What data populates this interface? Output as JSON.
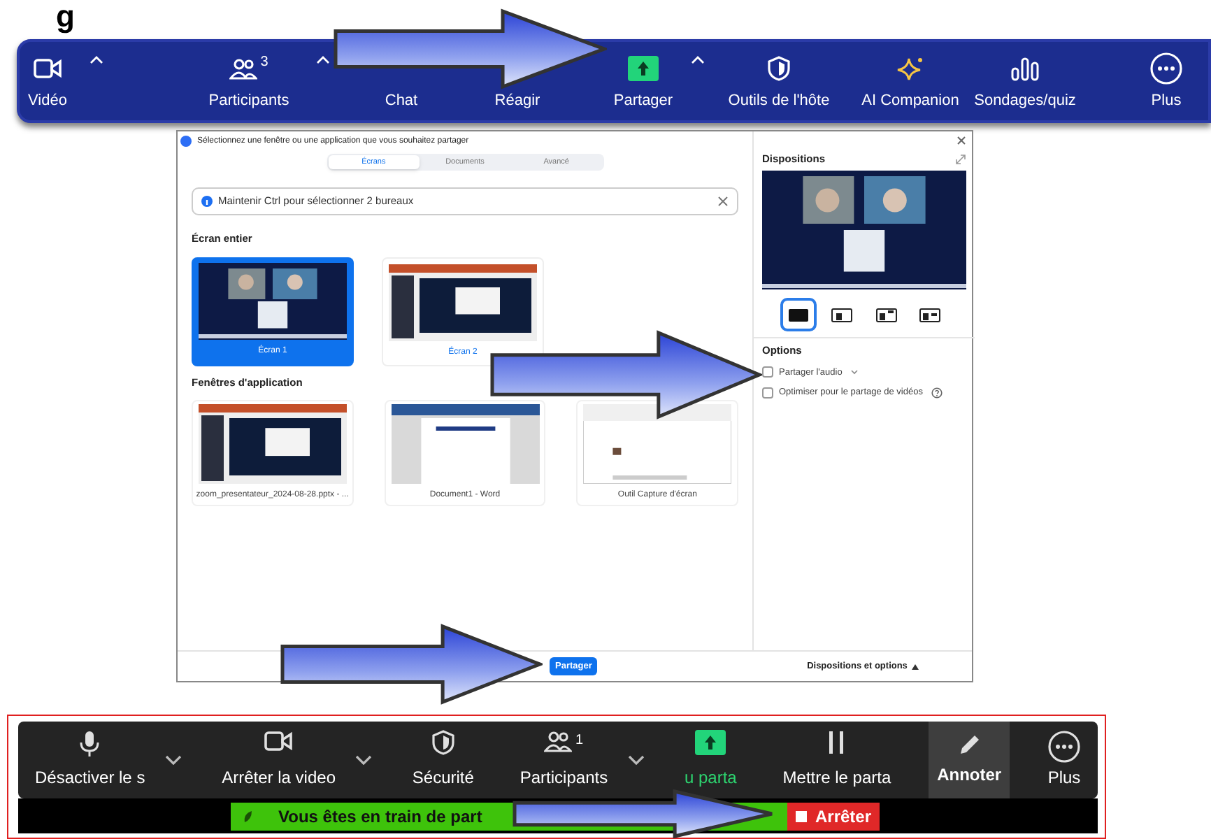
{
  "heading": {
    "text": "g"
  },
  "top_toolbar": {
    "items": [
      {
        "kind": "video",
        "label": "Vidéo",
        "caret": true
      },
      {
        "kind": "people",
        "label": "Participants",
        "badge": "3",
        "caret": true
      },
      {
        "kind": "label",
        "label": "Chat",
        "caret": false
      },
      {
        "kind": "label",
        "label": "Réagir",
        "caret": false
      },
      {
        "kind": "share",
        "label": "Partager",
        "caret": true
      },
      {
        "kind": "shield",
        "label": "Outils de l'hôte",
        "caret": false
      },
      {
        "kind": "sparkle",
        "label": "AI Companion",
        "caret": false
      },
      {
        "kind": "poll",
        "label": "Sondages/quiz",
        "caret": false
      },
      {
        "kind": "more",
        "label": "Plus",
        "caret": false
      }
    ]
  },
  "dialog": {
    "title": "Sélectionnez une fenêtre ou une application que vous souhaitez partager",
    "tabs": [
      {
        "label": "Écrans",
        "selected": true
      },
      {
        "label": "Documents",
        "selected": false
      },
      {
        "label": "Avancé",
        "selected": false
      }
    ],
    "info": "Maintenir Ctrl pour sélectionner 2 bureaux",
    "screens_heading": "Écran entier",
    "screens": [
      {
        "label": "Écran 1",
        "selected": true
      },
      {
        "label": "Écran 2",
        "selected": false
      }
    ],
    "apps_heading": "Fenêtres d'application",
    "apps": [
      {
        "label": "zoom_presentateur_2024-08-28.pptx - ..."
      },
      {
        "label": "Document1 - Word"
      },
      {
        "label": "Outil Capture d'écran"
      }
    ],
    "share_button": "Partager",
    "layouts_heading": "Dispositions",
    "layouts": [
      {
        "selected": true
      },
      {
        "selected": false
      },
      {
        "selected": false
      },
      {
        "selected": false
      }
    ],
    "options_heading": "Options",
    "options": [
      {
        "label": "Partager l'audio",
        "checked": false,
        "caret": true,
        "help": false
      },
      {
        "label": "Optimiser pour le partage de vidéos",
        "checked": false,
        "caret": false,
        "help": true
      }
    ],
    "footer": "Dispositions et options"
  },
  "bottom_toolbar": {
    "items": [
      {
        "kind": "mic",
        "label": "Désactiver le s",
        "caret": true,
        "selected": false
      },
      {
        "kind": "video",
        "label": "Arrêter la video",
        "caret": true,
        "selected": false
      },
      {
        "kind": "shield",
        "label": "Sécurité",
        "caret": false,
        "selected": false
      },
      {
        "kind": "people",
        "label": "Participants",
        "badge": "1",
        "caret": true,
        "selected": false
      },
      {
        "kind": "share",
        "label": "u parta",
        "caret": false,
        "selected": false
      },
      {
        "kind": "pause",
        "label": "Mettre le parta",
        "caret": false,
        "selected": false
      },
      {
        "kind": "pen",
        "label": "Annoter",
        "caret": false,
        "selected": true
      },
      {
        "kind": "more",
        "label": "Plus",
        "caret": false,
        "selected": false
      }
    ],
    "banner": "Vous êtes en train de part",
    "stop_button": "Arrêter"
  }
}
